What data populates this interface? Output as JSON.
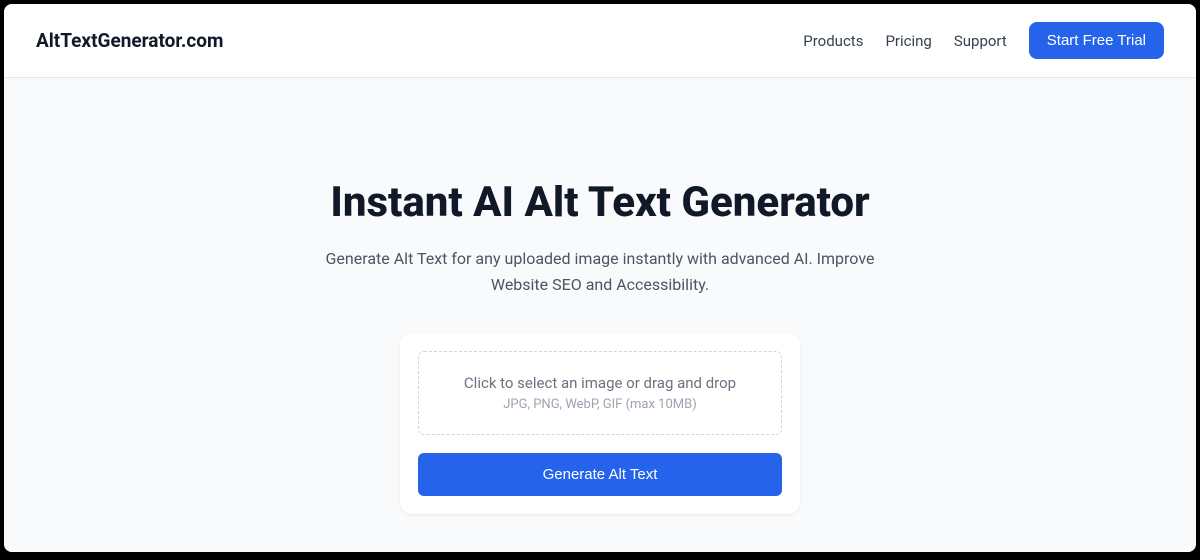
{
  "header": {
    "logo": "AltTextGenerator.com",
    "nav": {
      "products": "Products",
      "pricing": "Pricing",
      "support": "Support",
      "cta": "Start Free Trial"
    }
  },
  "hero": {
    "title": "Instant AI Alt Text Generator",
    "subtitle": "Generate Alt Text for any uploaded image instantly with advanced AI. Improve Website SEO and Accessibility."
  },
  "upload": {
    "dropzone_main": "Click to select an image or drag and drop",
    "dropzone_sub": "JPG, PNG, WebP, GIF (max 10MB)",
    "button": "Generate Alt Text"
  }
}
